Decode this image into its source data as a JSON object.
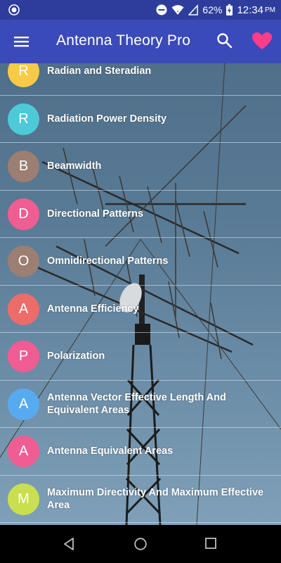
{
  "status_bar": {
    "battery": "62%",
    "time": "12:34",
    "ampm": "PM"
  },
  "app_bar": {
    "title": "Antenna Theory Pro",
    "colors": {
      "status": "#2e3d9c",
      "toolbar": "#3a4ab8",
      "heart": "#ff3d8b"
    }
  },
  "list": {
    "items": [
      {
        "letter": "R",
        "title": "Radian and Steradian",
        "color": "#f7cb47"
      },
      {
        "letter": "R",
        "title": "Radiation Power Density",
        "color": "#4dc9d7"
      },
      {
        "letter": "B",
        "title": "Beamwidth",
        "color": "#9c7e72"
      },
      {
        "letter": "D",
        "title": "Directional Patterns",
        "color": "#ef5d93"
      },
      {
        "letter": "O",
        "title": "Omnidirectional Patterns",
        "color": "#9c7e72"
      },
      {
        "letter": "A",
        "title": "Antenna Efficiency",
        "color": "#ec6c6a"
      },
      {
        "letter": "P",
        "title": "Polarization",
        "color": "#ef5d93"
      },
      {
        "letter": "A",
        "title": "Antenna Vector Effective Length And Equivalent Areas",
        "color": "#58aaf0"
      },
      {
        "letter": "A",
        "title": "Antenna Equivalent Areas",
        "color": "#ef5d93"
      },
      {
        "letter": "M",
        "title": "Maximum Directivity And Maximum Effective Area",
        "color": "#c9df4f"
      }
    ]
  }
}
